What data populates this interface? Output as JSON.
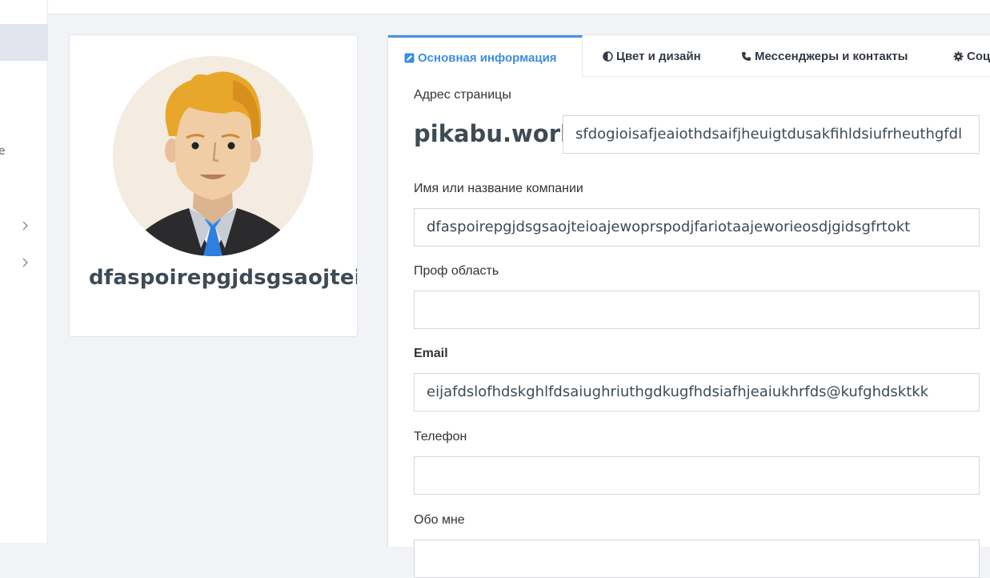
{
  "sidebar": {
    "partial_letter": "e"
  },
  "profile": {
    "name": "dfaspoirepgjdsgsaojteio"
  },
  "tabs": [
    {
      "label": "Основная информация",
      "icon": "edit-icon",
      "active": true
    },
    {
      "label": "Цвет и дизайн",
      "icon": "contrast-icon"
    },
    {
      "label": "Мессенджеры и контакты",
      "icon": "phone-icon"
    },
    {
      "label": "Соц",
      "icon": "gear-icon"
    }
  ],
  "form": {
    "page_address": {
      "label": "Адрес страницы",
      "prefix": "pikabu.work",
      "value": "sfdogioisafjeaiothdsaifjheuigtdusakfihldsiufrheuthgfdl"
    },
    "name": {
      "label": "Имя или название компании",
      "value": "dfaspoirepgjdsgsaojteioajewoprspodjfariotaajeworieosdjgidsgfrtokt"
    },
    "prof_area": {
      "label": "Проф область",
      "value": ""
    },
    "email": {
      "label": "Email",
      "value": "eijafdslofhdskghlfdsaiughriuthgdkugfhdsiafhjeaiukhrfds@kufghdsktkk"
    },
    "phone": {
      "label": "Телефон",
      "value": ""
    },
    "about": {
      "label": "Обо мне",
      "value": ""
    }
  },
  "colors": {
    "accent": "#4a90e2",
    "text_dark": "#3d4b55"
  }
}
